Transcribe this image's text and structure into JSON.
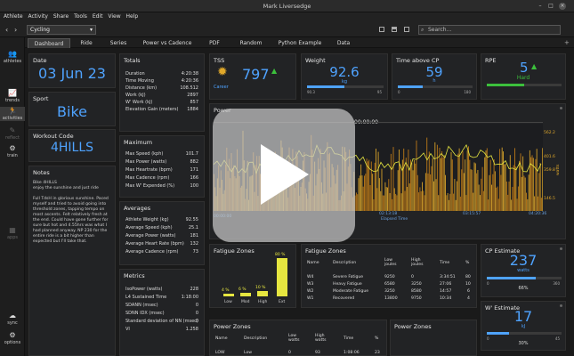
{
  "window": {
    "title": "Mark Liversedge"
  },
  "menu": [
    "Athlete",
    "Activity",
    "Share",
    "Tools",
    "Edit",
    "View",
    "Help"
  ],
  "toolbar": {
    "sport": "Cycling",
    "search_placeholder": "Search..."
  },
  "sidebar": [
    "athletes",
    "trends",
    "activities",
    "reflect",
    "train",
    "apps",
    "sync",
    "options"
  ],
  "tabs": [
    "Dashboard",
    "Ride",
    "Series",
    "Power vs Cadence",
    "PDF",
    "Random",
    "Python Example",
    "Data"
  ],
  "date": {
    "title": "Date",
    "value": "03 Jun 23"
  },
  "sport": {
    "title": "Sport",
    "value": "Bike"
  },
  "workout": {
    "title": "Workout Code",
    "value": "4HILLS"
  },
  "notes": {
    "title": "Notes",
    "line1": "Bike 4HILLS",
    "line2": "enjoy the sunshine and just ride",
    "body": "Full TdsH in glorious sunshine. Paced myself and tried to avoid going into threshold zones, tapping tempo on most ascents. Felt relatively fresh at the end. Could have gone further for sure but hot and 4.55hrs was what I had planned anyway. NP 230 for the entire ride is a bit higher than expected but I'll take that."
  },
  "totals": {
    "title": "Totals",
    "rows": [
      [
        "Duration",
        "4:20:38"
      ],
      [
        "Time Moving",
        "4:20:36"
      ],
      [
        "Distance (km)",
        "108.512"
      ],
      [
        "Work (kJ)",
        "2897"
      ],
      [
        "W' Work (kJ)",
        "857"
      ],
      [
        "Elevation Gain (meters)",
        "1884"
      ]
    ]
  },
  "maximum": {
    "title": "Maximum",
    "rows": [
      [
        "Max Speed (kph)",
        "101.7"
      ],
      [
        "Max Power (watts)",
        "882"
      ],
      [
        "Max Heartrate (bpm)",
        "171"
      ],
      [
        "Max Cadence (rpm)",
        "166"
      ],
      [
        "Max W' Expended (%)",
        "100"
      ]
    ]
  },
  "averages": {
    "title": "Averages",
    "rows": [
      [
        "Athlete Weight (kg)",
        "92.55"
      ],
      [
        "Average Speed (kph)",
        "25.1"
      ],
      [
        "Average Power (watts)",
        "181"
      ],
      [
        "Average Heart Rate (bpm)",
        "132"
      ],
      [
        "Average Cadence (rpm)",
        "73"
      ]
    ]
  },
  "metrics": {
    "title": "Metrics",
    "rows": [
      [
        "IsoPower (watts)",
        "228"
      ],
      [
        "L4 Sustained Time",
        "1:18:00"
      ],
      [
        "SDANN (msec)",
        "0"
      ],
      [
        "SDNN IDX (msec)",
        "0"
      ],
      [
        "Standard deviation of NN (msec)",
        "0"
      ],
      [
        "VI",
        "1.258"
      ]
    ]
  },
  "tss": {
    "title": "TSS",
    "value": "797",
    "badge": "Career"
  },
  "weight": {
    "title": "Weight",
    "value": "92.6",
    "unit": "kg",
    "min": "90.3",
    "max": "95"
  },
  "abovecp": {
    "title": "Time above CP",
    "value": "59",
    "unit": "h",
    "min": "0",
    "max": "180"
  },
  "rpe": {
    "title": "RPE",
    "value": "5",
    "label": "Hard"
  },
  "power": {
    "title": "Power",
    "time_label": "00:00:00",
    "x_ticks": [
      "00:00:00",
      "02:13:18",
      "03:15:57",
      "04:20:36"
    ],
    "xlabel": "Elapsed Time",
    "y_labels": [
      "562.2",
      "401.6",
      "359.8",
      "146.5"
    ],
    "ylabel": "watts"
  },
  "fatigue_chart": {
    "title": "Fatigue Zones",
    "bars": [
      {
        "label": "Low",
        "pct": "4 %"
      },
      {
        "label": "Mod",
        "pct": "6 %"
      },
      {
        "label": "High",
        "pct": "10 %"
      },
      {
        "label": "Ext",
        "pct": "80 %"
      }
    ]
  },
  "fatigue_table": {
    "title": "Fatigue Zones",
    "headers": [
      "Name",
      "Description",
      "Low joules",
      "High joules",
      "Time",
      "%"
    ],
    "rows": [
      [
        "W4",
        "Severe Fatigue",
        "9250",
        "0",
        "3:34:51",
        "80"
      ],
      [
        "W3",
        "Heavy Fatigue",
        "6580",
        "3250",
        "27:06",
        "10"
      ],
      [
        "W2",
        "Moderate Fatigue",
        "3250",
        "8580",
        "14:57",
        "6"
      ],
      [
        "W1",
        "Recovered",
        "13800",
        "9750",
        "10:34",
        "4"
      ]
    ]
  },
  "cp": {
    "title": "CP Estimate",
    "value": "237",
    "unit": "watts",
    "pct": "66%",
    "min": "0",
    "max": "360"
  },
  "wprime": {
    "title": "W' Estimate",
    "value": "17",
    "unit": "kJ",
    "pct": "30%",
    "min": "0",
    "max": "45"
  },
  "powerzones_table": {
    "title": "Power Zones",
    "headers": [
      "Name",
      "Description",
      "Low watts",
      "High watts",
      "Time",
      "%"
    ],
    "row": [
      "LOW",
      "Low",
      "0",
      "93",
      "1:08:06",
      "23"
    ]
  },
  "powerzones": {
    "title": "Power Zones"
  }
}
